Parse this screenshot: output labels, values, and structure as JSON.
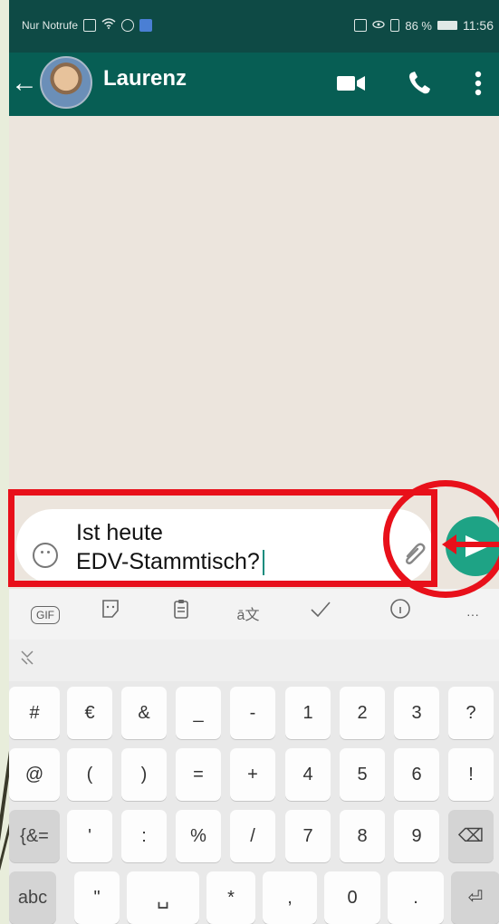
{
  "status_bar": {
    "carrier": "Nur Notrufe",
    "battery_percent": "86 %",
    "time": "11:56"
  },
  "app_bar": {
    "contact_name": "Laurenz",
    "icons": [
      "back-arrow",
      "avatar",
      "video-call",
      "phone-call",
      "more-vertical"
    ]
  },
  "composer": {
    "message_line1": "Ist heute",
    "message_line2": "EDV-Stammtisch?",
    "icons": [
      "emoji",
      "paperclip",
      "send"
    ]
  },
  "toolbar": {
    "gif_label": "GIF",
    "icons": [
      "gif",
      "sticker",
      "clipboard",
      "translate",
      "checkmark",
      "info",
      "more"
    ],
    "more_label": "···"
  },
  "keyboard": {
    "collapse_icon": "chevron-collapse",
    "rows": [
      [
        "#",
        "€",
        "&",
        "_",
        "-",
        "1",
        "2",
        "3",
        "?"
      ],
      [
        "@",
        "(",
        ")",
        "=",
        "+",
        "4",
        "5",
        "6",
        "!"
      ],
      [
        "{&=",
        "'",
        ":",
        "%",
        "/",
        "7",
        "8",
        "9",
        "⌫"
      ],
      [
        "abc",
        "\"",
        "␣",
        "*",
        ",",
        "0",
        ".",
        "⏎"
      ]
    ]
  },
  "colors": {
    "app_bar": "#075e54",
    "status_bar": "#0e4a45",
    "send_button": "#1ea385",
    "annotation": "#e8101a",
    "chat_background": "#ece5dd"
  }
}
